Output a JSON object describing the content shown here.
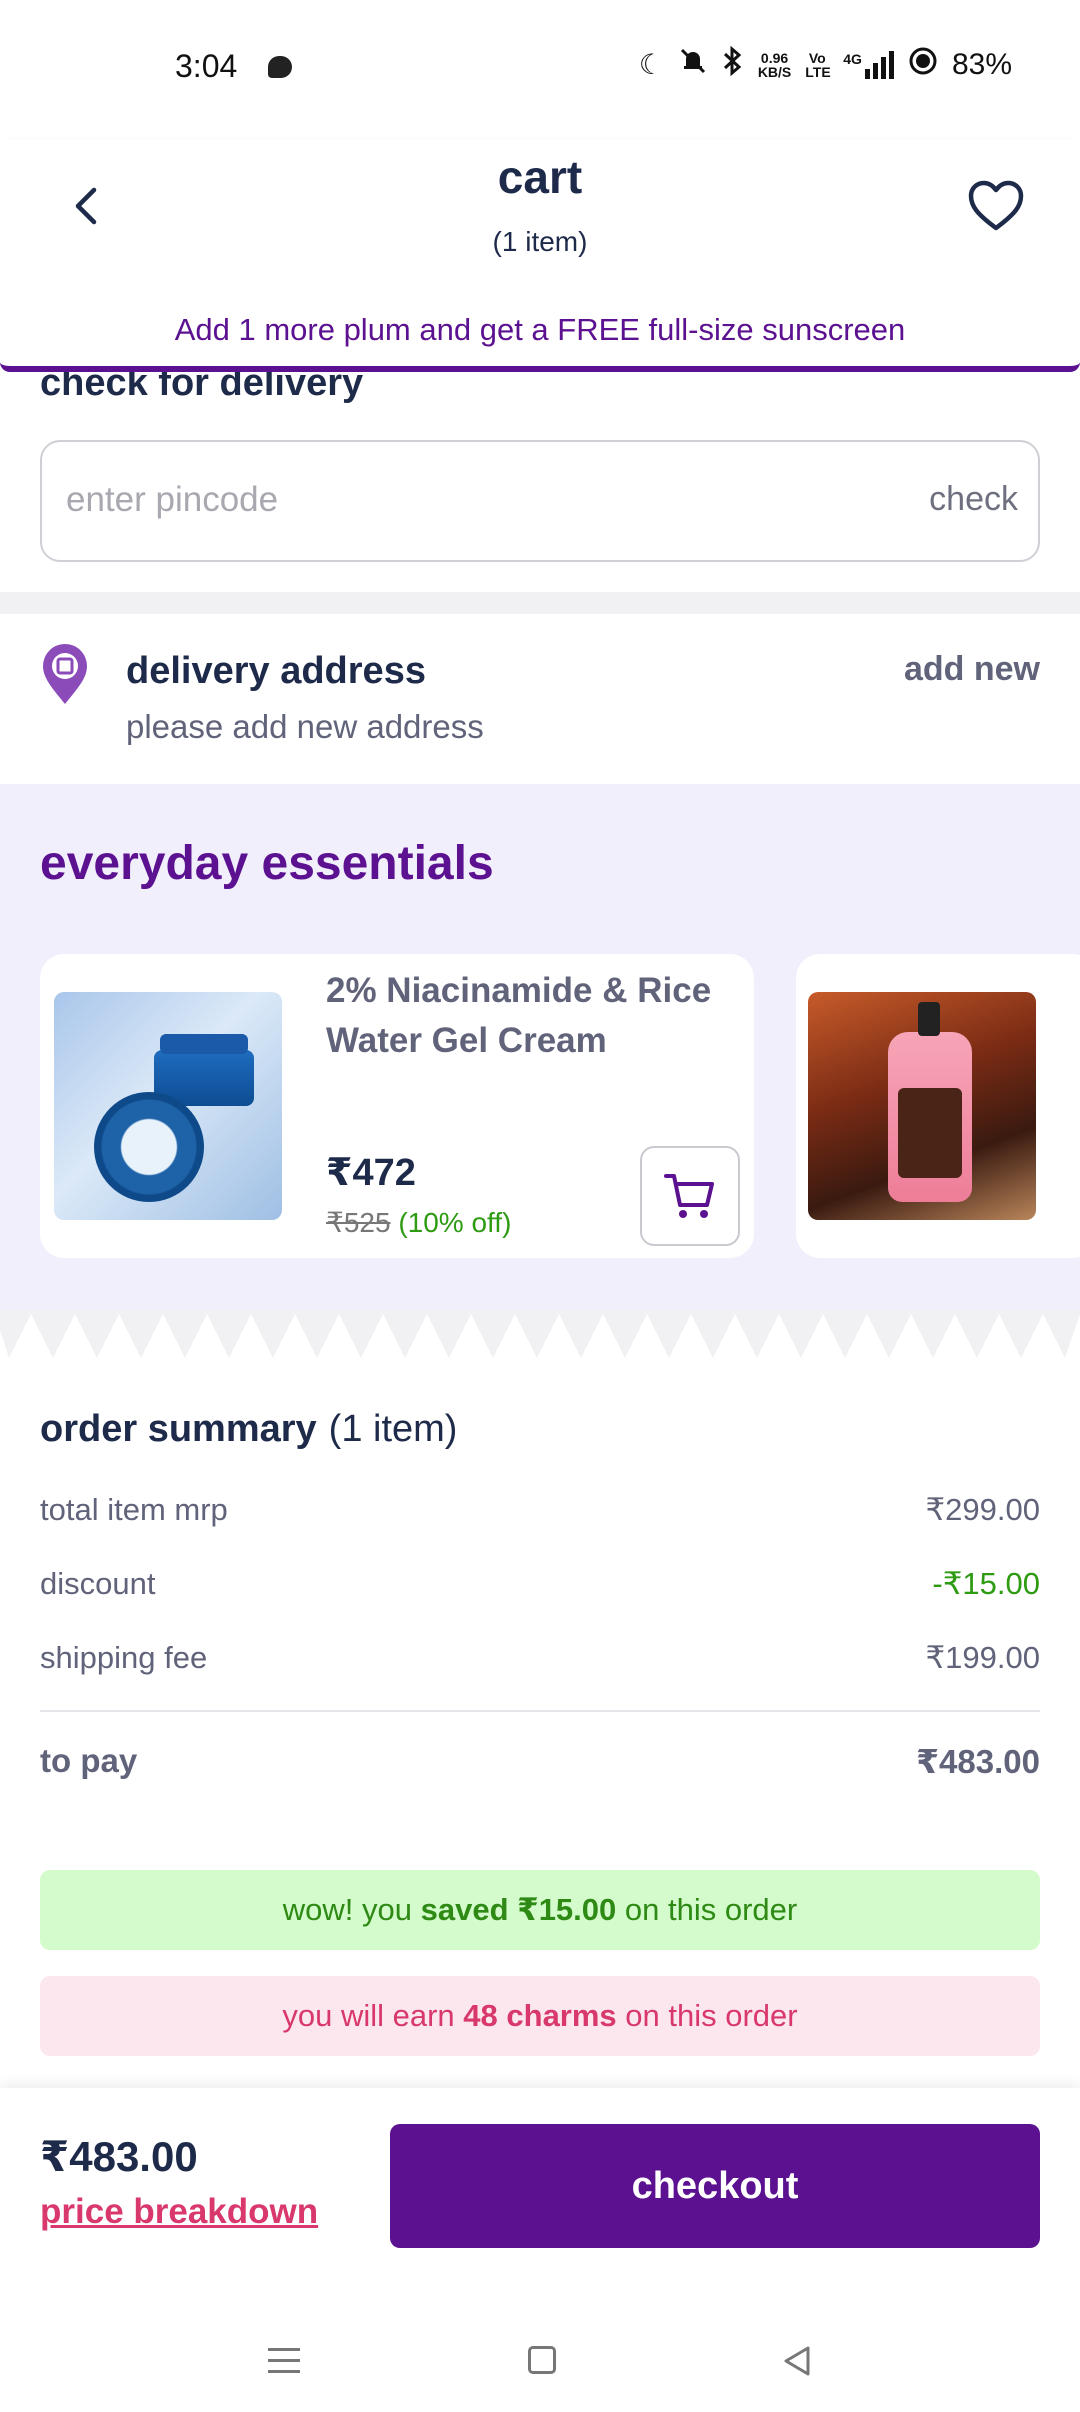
{
  "status_bar": {
    "time": "3:04",
    "net_speed_value": "0.96",
    "net_speed_unit": "KB/S",
    "volte": "Vo LTE",
    "network": "4G",
    "battery": "83%"
  },
  "header": {
    "title": "cart",
    "subtitle": "(1 item)"
  },
  "promo_banner": "Add 1 more plum and get a FREE full-size sunscreen",
  "delivery_check": {
    "title": "check for delivery",
    "placeholder": "enter pincode",
    "button": "check"
  },
  "delivery_address": {
    "title": "delivery address",
    "subtitle": "please add new address",
    "action": "add new"
  },
  "essentials": {
    "title": "everyday essentials",
    "products": [
      {
        "name": "2% Niacinamide & Rice Water Gel Cream",
        "price": "₹472",
        "mrp": "₹525",
        "discount": "(10% off)"
      }
    ]
  },
  "order_summary": {
    "title": "order summary",
    "count": "(1 item)",
    "rows": [
      {
        "label": "total item mrp",
        "value": "₹299.00"
      },
      {
        "label": "discount",
        "value": "-₹15.00"
      },
      {
        "label": "shipping fee",
        "value": "₹199.00"
      }
    ],
    "to_pay_label": "to pay",
    "to_pay_value": "₹483.00"
  },
  "savings": {
    "prefix": "wow! you ",
    "amount": "saved ₹15.00",
    "suffix": " on this order"
  },
  "charms": {
    "prefix": "you will earn ",
    "amount": "48 charms",
    "suffix": " on this order"
  },
  "footer": {
    "total": "₹483.00",
    "breakdown_link": "price breakdown",
    "checkout_label": "checkout"
  },
  "colors": {
    "brand_purple": "#5b1190",
    "navy": "#1e2a4a",
    "success_green": "#2e9b12",
    "pink": "#d8386b",
    "essentials_bg": "#f1effc"
  }
}
